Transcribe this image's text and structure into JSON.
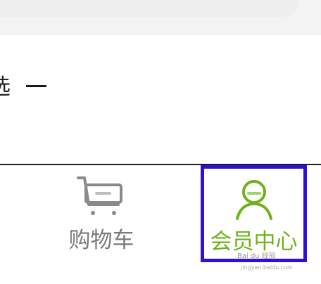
{
  "content": {
    "option_text": "选",
    "dash": "一"
  },
  "tabbar": {
    "items": [
      {
        "label": "购物车",
        "icon": "shopping-cart-icon",
        "color": "#7a7a7a",
        "selected": false
      },
      {
        "label": "会员中心",
        "icon": "user-icon",
        "color": "#6fb21b",
        "selected": true
      }
    ],
    "highlight_color": "#2b12d6"
  },
  "watermark": {
    "text": "Bai du 经验",
    "url": "jingyan.baidu.com"
  }
}
